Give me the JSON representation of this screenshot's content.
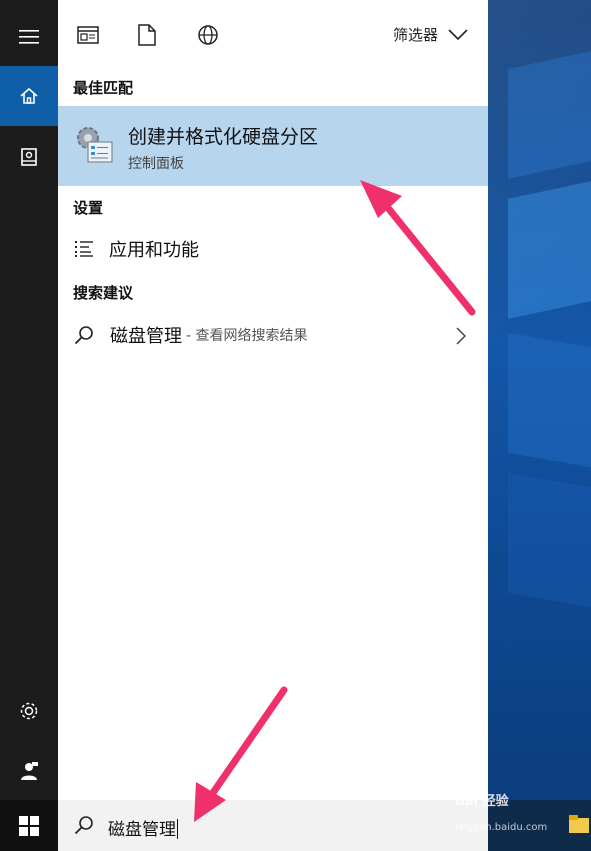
{
  "panel": {
    "filter_label": "筛选器",
    "sections": {
      "best_match": "最佳匹配",
      "settings": "设置",
      "suggestions": "搜索建议"
    },
    "best_match": {
      "title": "创建并格式化硬盘分区",
      "subtitle": "控制面板"
    },
    "settings_items": [
      {
        "label": "应用和功能",
        "icon": "list-icon"
      }
    ],
    "suggestion_items": [
      {
        "label": "磁盘管理",
        "hint": "- 查看网络搜索结果",
        "icon": "search-icon"
      }
    ]
  },
  "searchbox": {
    "query": "磁盘管理",
    "icon": "search-icon"
  },
  "rail": {
    "icons": [
      "hamburger-menu-icon",
      "home-icon",
      "notebook-icon",
      "gear-icon",
      "feedback-person-icon",
      "windows-start-icon"
    ]
  },
  "watermark": {
    "brand": "Bai 经验",
    "url": "jingyan.baidu.com"
  },
  "colors": {
    "accent": "#0f5fa8",
    "highlight": "#b7d6ee",
    "arrow": "#f0306a",
    "rail": "#1c1c1c"
  }
}
